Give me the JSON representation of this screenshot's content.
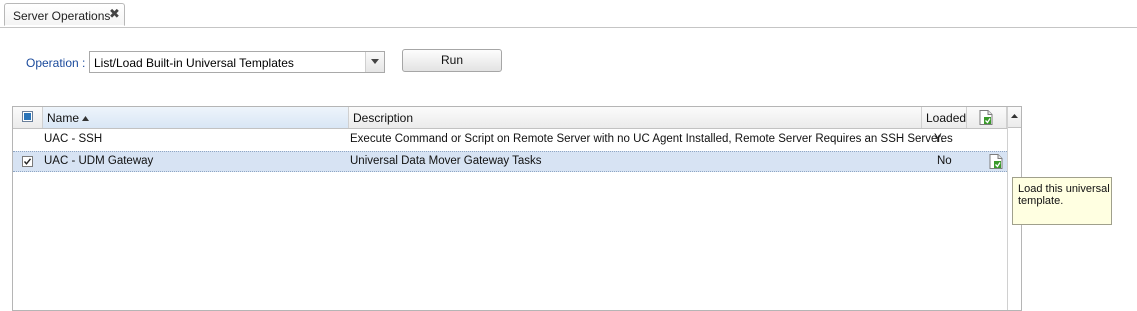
{
  "tabs": [
    {
      "label": "Server Operations",
      "close_icon": "close-icon",
      "close_glyph": "✖"
    }
  ],
  "operation": {
    "label": "Operation :",
    "selected": "List/Load Built-in Universal Templates",
    "run_label": "Run"
  },
  "grid": {
    "columns": {
      "name": "Name",
      "description": "Description",
      "loaded": "Loaded"
    },
    "sort": {
      "column": "Name",
      "direction": "ascending"
    },
    "rows": [
      {
        "name": "UAC - SSH",
        "description": "Execute Command or Script on Remote Server with no UC Agent Installed, Remote Server Requires an SSH Server.",
        "loaded": "Yes",
        "checked": false,
        "show_load_icon": false
      },
      {
        "name": "UAC - UDM Gateway",
        "description": "Universal Data Mover Gateway Tasks",
        "loaded": "No",
        "checked": true,
        "show_load_icon": true
      }
    ]
  },
  "tooltip": {
    "text": "Load this universal template."
  },
  "colors": {
    "label_blue": "#1a4a9c",
    "selected_row": "#d7e3f3",
    "tooltip_bg": "#ffffe1",
    "icon_green": "#3a9a2a"
  }
}
